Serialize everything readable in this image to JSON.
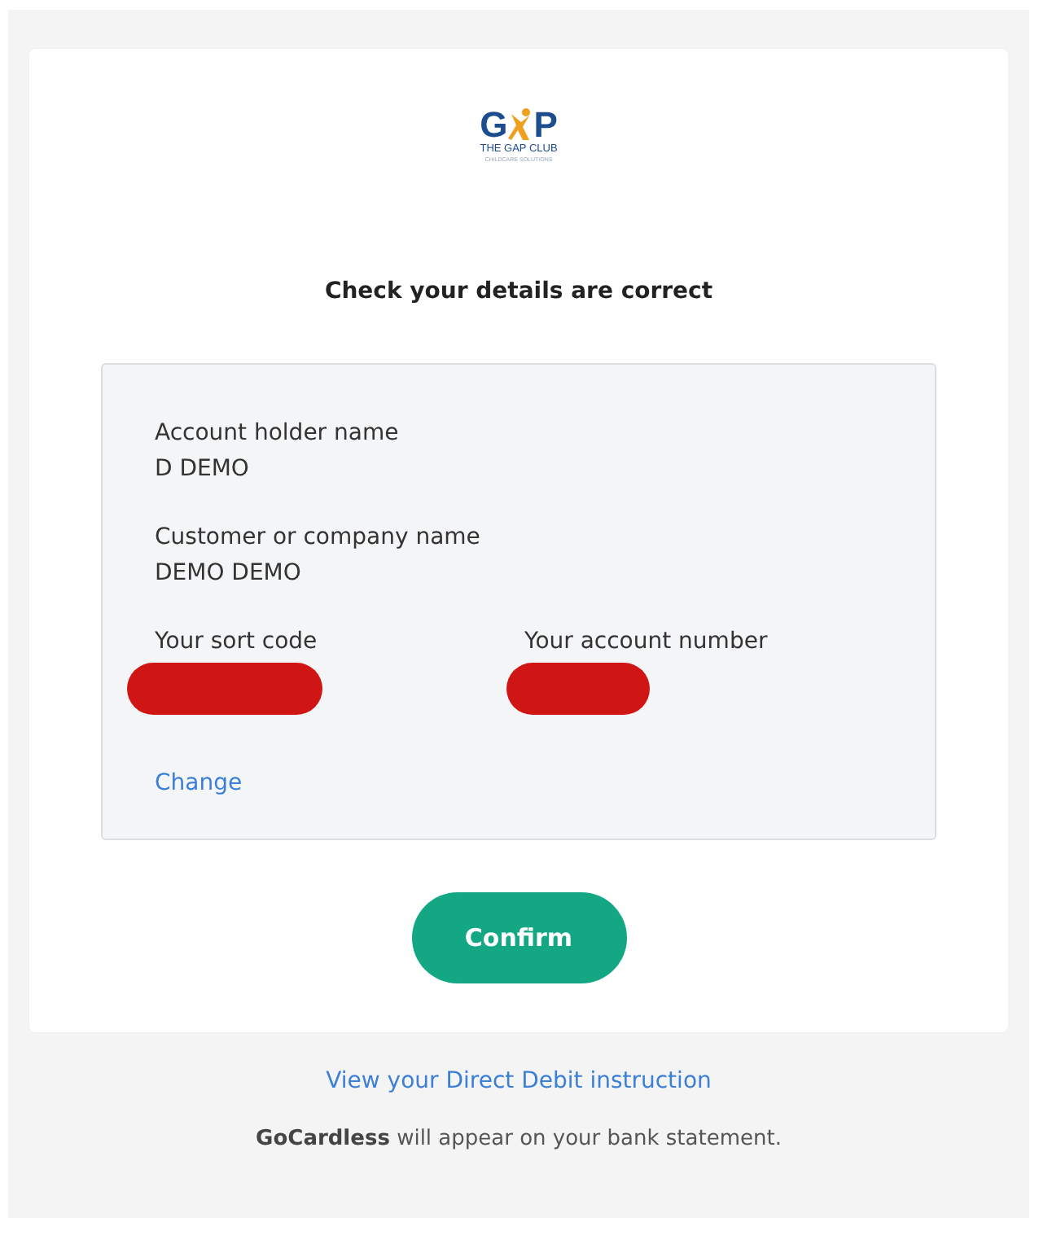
{
  "logo": {
    "letters": [
      "G",
      "P"
    ],
    "name": "THE GAP CLUB",
    "tagline": "CHILDCARE SOLUTIONS"
  },
  "heading": "Check your details are correct",
  "details": [
    {
      "label": "Account holder name",
      "value": "D DEMO",
      "redacted": false
    },
    {
      "label": "Customer or company name",
      "value": "DEMO DEMO",
      "redacted": false
    }
  ],
  "bank_fields": [
    {
      "label": "Your sort code",
      "redacted": true
    },
    {
      "label": "Your account number",
      "redacted": true
    }
  ],
  "change_link": "Change",
  "confirm_button": "Confirm",
  "instruction_link": "View your Direct Debit instruction",
  "footer_note": "**GoCardless** will appear on your bank statement."
}
